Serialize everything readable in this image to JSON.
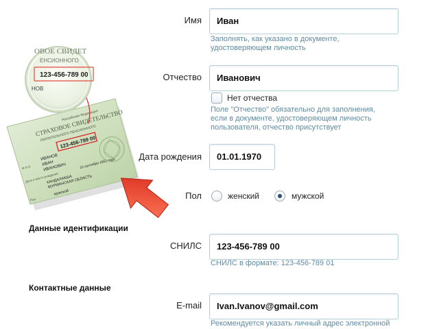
{
  "form": {
    "first_name": {
      "label": "Имя",
      "value": "Иван",
      "hint_line1": "Заполнять, как указано в документе,",
      "hint_line2": "удостоверяющем личность"
    },
    "patronymic": {
      "label": "Отчество",
      "value": "Иванович",
      "no_patronymic_label": "Нет отчества",
      "hint_line1": "Поле \"Отчество\" обязательно для заполнения,",
      "hint_line2": "если в документе, удостоверяющем личность",
      "hint_line3": "пользователя, отчество присутствует"
    },
    "birth_date": {
      "label": "Дата рождения",
      "value": "01.01.1970"
    },
    "gender": {
      "label": "Пол",
      "female": "женский",
      "male": "мужской",
      "selected": "мужской"
    },
    "identification": {
      "section_title": "Данные идентификации",
      "snils_label": "СНИЛС",
      "snils_value": "123-456-789 00",
      "snils_hint": "СНИЛС в формате: 123-456-789 01"
    },
    "contacts": {
      "section_title": "Контактные данные",
      "email_label": "E-mail",
      "email_value": "Ivan.Ivanov@gmail.com",
      "email_hint": "Рекомендуется указать личный адрес электронной"
    }
  },
  "card_illustration": {
    "magnified_number": "123-456-789 00",
    "magnified_line1": "ОВОЕ СВИДЕТ",
    "magnified_line2": "ЕНСИОННОГО",
    "magnified_line3": "НОВ",
    "card_title_top": "Российская Федерация",
    "card_title": "СТРАХОВОЕ СВИДЕТЕЛЬСТВО",
    "card_subtitle": "ОБЯЗАТЕЛЬНОГО ПЕНСИОННОГО",
    "card_number": "123-456-789 00",
    "card_surname": "ИВАНОВ",
    "card_name": "ИВАН",
    "card_patronymic": "ИВАНОВИЧ",
    "card_fio_label": "Ф.И.О.",
    "card_birth_label": "Дата и место рождения",
    "card_birth_date": "15 сентября 1961 года",
    "card_city": "КАНДАЛАКША",
    "card_region": "МУРМАНСКАЯ ОБЛАСТЬ",
    "card_gender_label": "Пол",
    "card_gender": "мужской"
  },
  "colors": {
    "input_border": "#b7d0dc",
    "hint": "#5f8aa0",
    "arrow": "#e8392a",
    "card": "#c9dbb8"
  }
}
